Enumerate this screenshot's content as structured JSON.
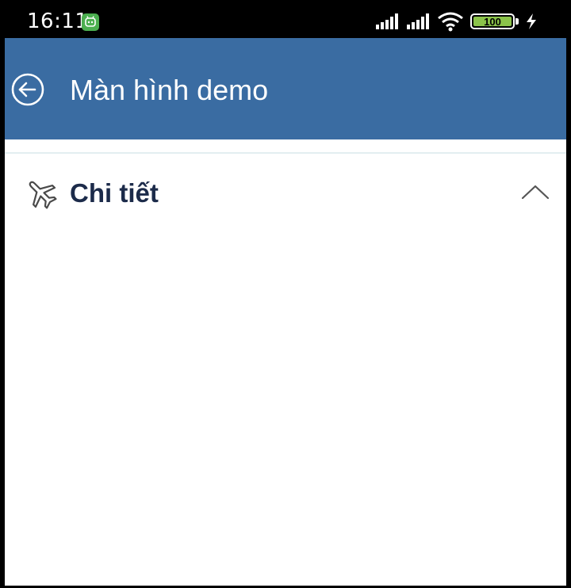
{
  "status_bar": {
    "time": "16:11",
    "battery": "100"
  },
  "header": {
    "title": "Màn hình demo",
    "background_color": "#3a6ca2"
  },
  "section": {
    "title": "Chi tiết",
    "expanded": true
  },
  "colors": {
    "section_title": "#1c2b4a",
    "divider": "#e3eef1"
  }
}
